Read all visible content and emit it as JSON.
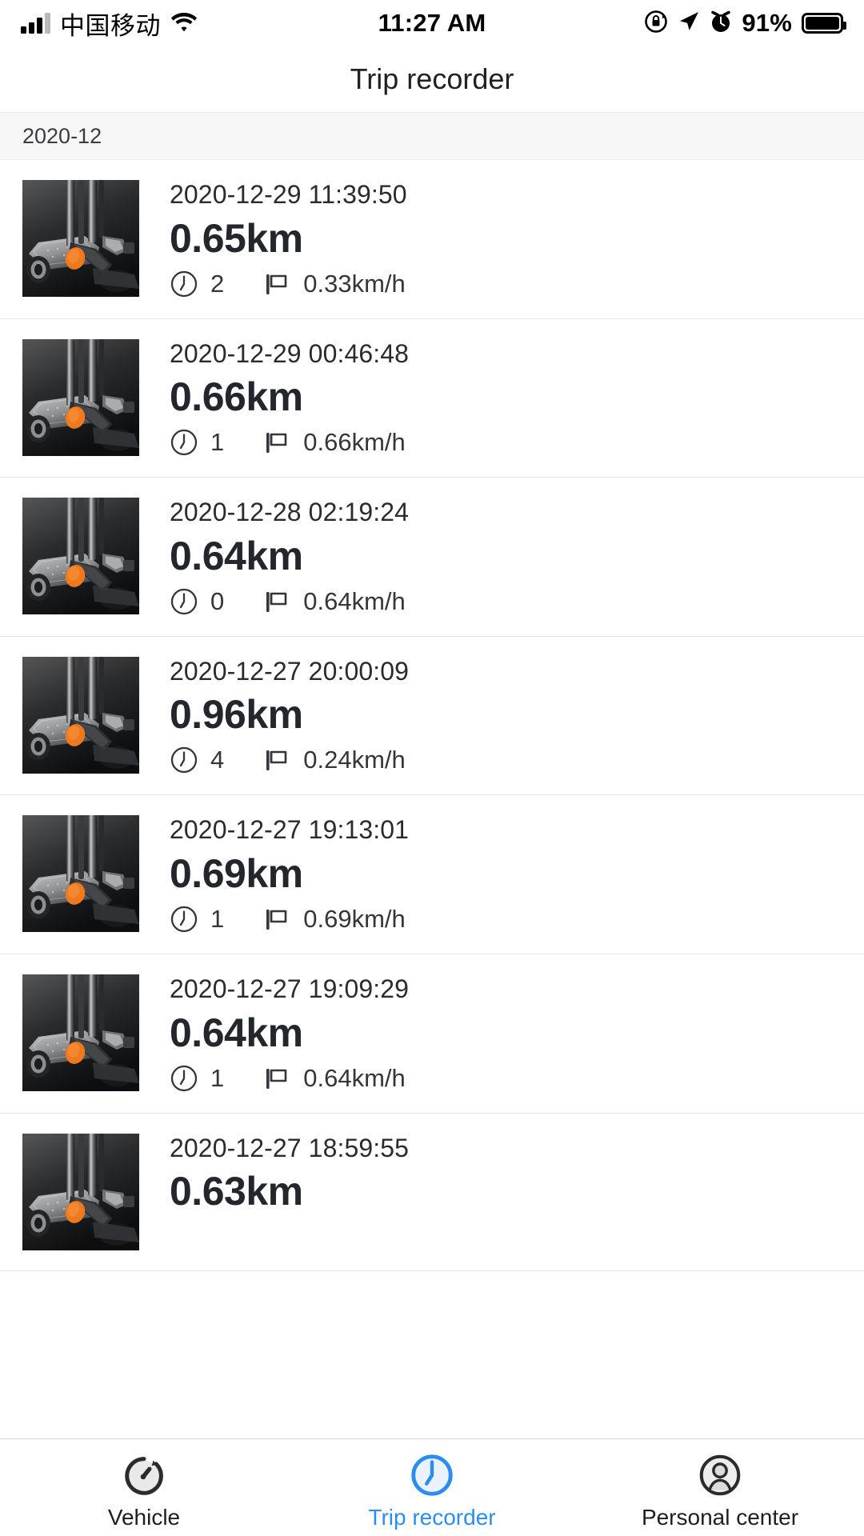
{
  "status_bar": {
    "carrier": "中国移动",
    "time": "11:27 AM",
    "battery_percent": "91%",
    "icons": {
      "signal": "signal-bars-icon",
      "wifi": "wifi-icon",
      "rotation_lock": "rotation-lock-icon",
      "location": "location-arrow-icon",
      "alarm": "alarm-clock-icon",
      "battery": "battery-icon"
    }
  },
  "nav": {
    "title": "Trip recorder"
  },
  "list": {
    "section_header": "2020-12",
    "rows": [
      {
        "datetime": "2020-12-29 11:39:50",
        "distance": "0.65km",
        "duration": "2",
        "speed": "0.33km/h"
      },
      {
        "datetime": "2020-12-29 00:46:48",
        "distance": "0.66km",
        "duration": "1",
        "speed": "0.66km/h"
      },
      {
        "datetime": "2020-12-28 02:19:24",
        "distance": "0.64km",
        "duration": "0",
        "speed": "0.64km/h"
      },
      {
        "datetime": "2020-12-27 20:00:09",
        "distance": "0.96km",
        "duration": "4",
        "speed": "0.24km/h"
      },
      {
        "datetime": "2020-12-27 19:13:01",
        "distance": "0.69km",
        "duration": "1",
        "speed": "0.69km/h"
      },
      {
        "datetime": "2020-12-27 19:09:29",
        "distance": "0.64km",
        "duration": "1",
        "speed": "0.64km/h"
      },
      {
        "datetime": "2020-12-27 18:59:55",
        "distance": "0.63km",
        "duration": "",
        "speed": ""
      }
    ]
  },
  "tab_bar": {
    "active_color": "#2d8cf0",
    "inactive_color": "#1d1e22",
    "tabs": [
      {
        "label": "Vehicle",
        "icon": "speedometer-icon",
        "active": false
      },
      {
        "label": "Trip recorder",
        "icon": "clock-icon",
        "active": true
      },
      {
        "label": "Personal center",
        "icon": "user-circle-icon",
        "active": false
      }
    ]
  }
}
